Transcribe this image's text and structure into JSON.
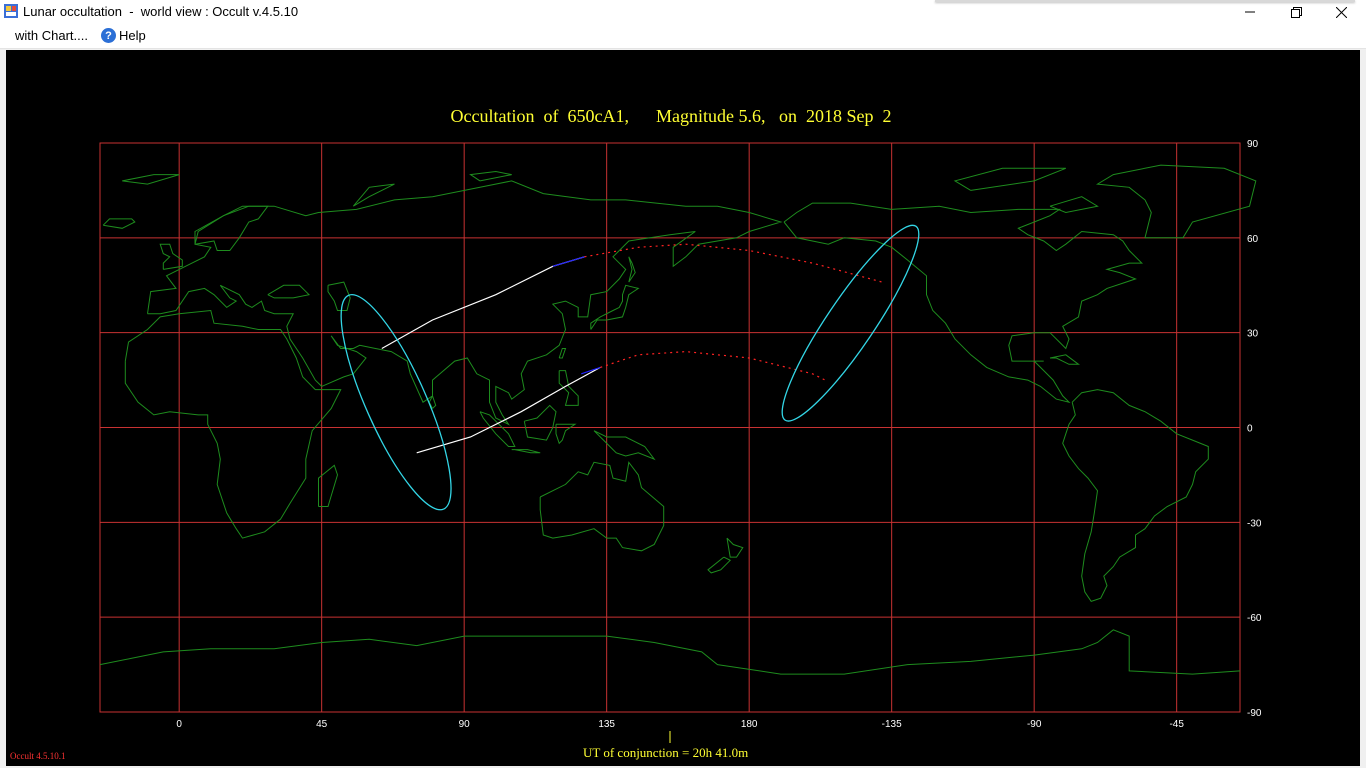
{
  "window": {
    "title": "Lunar occultation  -  world view : Occult v.4.5.10",
    "minimize_icon": "minimize-icon",
    "restore_icon": "restore-icon",
    "close_icon": "close-icon"
  },
  "menu": {
    "items": [
      {
        "label": "with Chart...."
      },
      {
        "label": "Help",
        "icon": "help-icon"
      }
    ]
  },
  "chart_data": {
    "type": "map",
    "title": "Occultation  of  650cA1,      Magnitude 5.6,   on  2018 Sep  2",
    "projection": "equirectangular",
    "xlim": [
      -25,
      -10
    ],
    "ylim": [
      -90,
      90
    ],
    "grid": true,
    "x_ticks": [
      "0",
      "45",
      "90",
      "135",
      "180",
      "-135",
      "-90",
      "-45"
    ],
    "x_tick_values": [
      0,
      45,
      90,
      135,
      180,
      225,
      270,
      315
    ],
    "y_ticks": [
      "90",
      "60",
      "30",
      "0",
      "-30",
      "-60",
      "-90"
    ],
    "y_tick_values": [
      90,
      60,
      30,
      0,
      -30,
      -60,
      -90
    ],
    "conjunction_marker_lon": 155,
    "colors": {
      "background": "#000000",
      "grid": "#c83232",
      "coastline": "#1e8c1e",
      "path_visible": "#ffffff",
      "path_twilight": "#2222ff",
      "path_not_visible": "#ff2222",
      "rise_set_curve": "#33d6e6",
      "title": "#ffff33"
    },
    "northern_limit": [
      [
        64,
        25
      ],
      [
        80,
        34
      ],
      [
        100,
        42
      ],
      [
        118,
        51
      ],
      [
        128,
        54
      ]
    ],
    "northern_limit_twilight": [
      [
        118,
        51
      ],
      [
        128,
        54
      ]
    ],
    "northern_limit_dotted": [
      [
        128,
        54
      ],
      [
        145,
        57
      ],
      [
        160,
        58
      ],
      [
        180,
        56
      ],
      [
        200,
        52
      ],
      [
        222,
        46
      ]
    ],
    "southern_limit": [
      [
        75,
        -8
      ],
      [
        92,
        -3
      ],
      [
        108,
        5
      ],
      [
        122,
        13
      ],
      [
        133,
        19
      ]
    ],
    "southern_limit_twilight": [
      [
        127,
        17
      ],
      [
        133,
        19
      ]
    ],
    "southern_limit_dotted": [
      [
        133,
        19
      ],
      [
        145,
        23
      ],
      [
        160,
        24
      ],
      [
        180,
        22
      ],
      [
        200,
        17
      ],
      [
        204,
        15
      ]
    ],
    "rise_set_west": {
      "center_lon": 68.5,
      "center_lat": 8,
      "notes": "tilted loop"
    },
    "rise_set_east": {
      "center_lon": 212,
      "center_lat": 33,
      "notes": "tilted loop"
    }
  },
  "footer": {
    "ut_label": "UT of conjunction = 20h 41.0m",
    "version": "Occult 4.5.10.1"
  }
}
